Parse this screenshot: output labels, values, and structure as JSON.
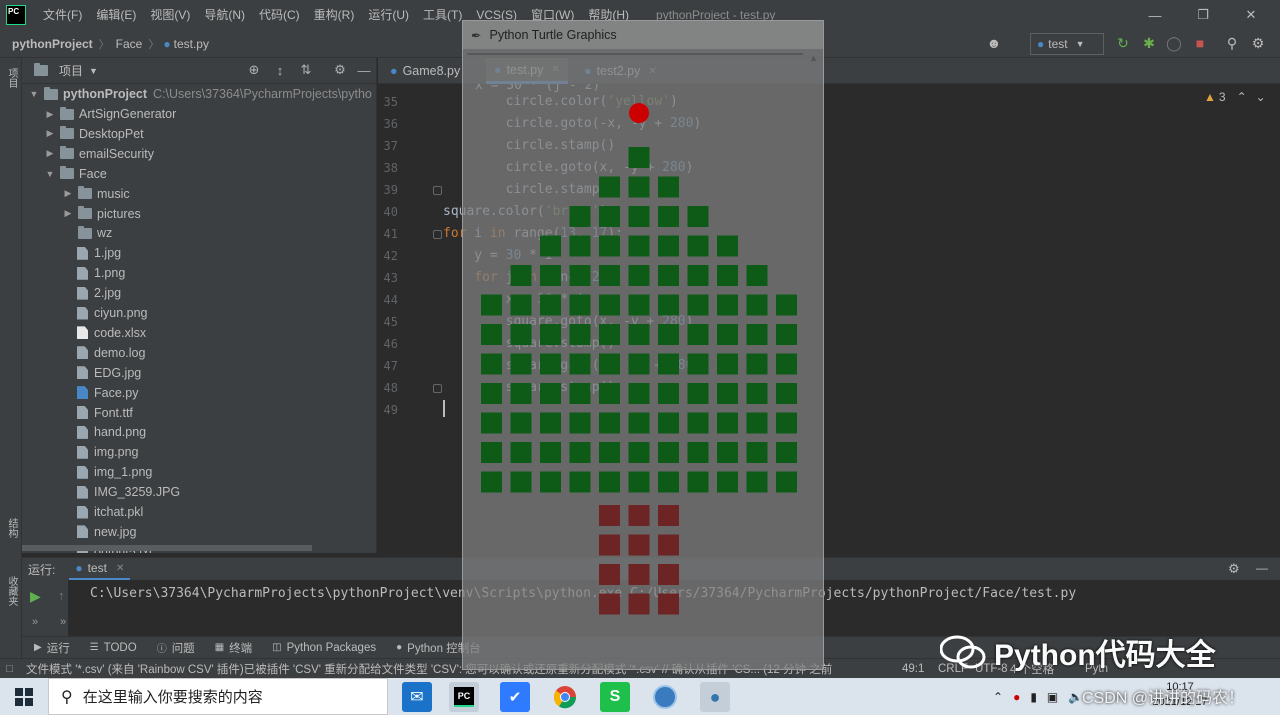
{
  "window": {
    "menu": [
      "文件(F)",
      "编辑(E)",
      "视图(V)",
      "导航(N)",
      "代码(C)",
      "重构(R)",
      "运行(U)",
      "工具(T)",
      "VCS(S)",
      "窗口(W)",
      "帮助(H)"
    ],
    "title": "pythonProject - test.py",
    "logo_text": "PC"
  },
  "breadcrumb": [
    "pythonProject",
    "Face",
    "test.py"
  ],
  "run_config": "test",
  "left_strip": {
    "project_label": "项目",
    "structure_label": "结构",
    "favorites_label": "收藏夹"
  },
  "project_panel": {
    "title": "项目",
    "root": {
      "name": "pythonProject",
      "path": "C:\\Users\\37364\\PycharmProjects\\pytho"
    },
    "items": [
      {
        "name": "ArtSignGenerator",
        "type": "folder",
        "level": 1,
        "expanded": false
      },
      {
        "name": "DesktopPet",
        "type": "folder",
        "level": 1,
        "expanded": false
      },
      {
        "name": "emailSecurity",
        "type": "folder",
        "level": 1,
        "expanded": false
      },
      {
        "name": "Face",
        "type": "folder",
        "level": 1,
        "expanded": true
      },
      {
        "name": "music",
        "type": "folder",
        "level": 2,
        "expanded": false
      },
      {
        "name": "pictures",
        "type": "folder",
        "level": 2,
        "expanded": false
      },
      {
        "name": "wz",
        "type": "folder",
        "level": 2,
        "expanded": null
      },
      {
        "name": "1.jpg",
        "type": "file",
        "level": 2
      },
      {
        "name": "1.png",
        "type": "file",
        "level": 2
      },
      {
        "name": "2.jpg",
        "type": "file",
        "level": 2
      },
      {
        "name": "ciyun.png",
        "type": "file",
        "level": 2
      },
      {
        "name": "code.xlsx",
        "type": "xlsx",
        "level": 2
      },
      {
        "name": "demo.log",
        "type": "file",
        "level": 2
      },
      {
        "name": "EDG.jpg",
        "type": "file",
        "level": 2
      },
      {
        "name": "Face.py",
        "type": "py",
        "level": 2
      },
      {
        "name": "Font.ttf",
        "type": "file",
        "level": 2
      },
      {
        "name": "hand.png",
        "type": "file",
        "level": 2
      },
      {
        "name": "img.png",
        "type": "file",
        "level": 2
      },
      {
        "name": "img_1.png",
        "type": "file",
        "level": 2
      },
      {
        "name": "IMG_3259.JPG",
        "type": "file",
        "level": 2
      },
      {
        "name": "itchat.pkl",
        "type": "file",
        "level": 2
      },
      {
        "name": "new.jpg",
        "type": "file",
        "level": 2
      },
      {
        "name": "output5.txt",
        "type": "file",
        "level": 2
      }
    ]
  },
  "editor": {
    "tabs": [
      {
        "label": "Game8.py",
        "active": false
      },
      {
        "label": "test.py",
        "active": true
      },
      {
        "label": "test2.py",
        "active": false
      }
    ],
    "warnings": "3",
    "first_partial_line": "x = 30 * (j - 2)",
    "lines": [
      {
        "n": 35,
        "text": "        circle.color('yellow')"
      },
      {
        "n": 36,
        "text": "        circle.goto(-x, -y + 280)"
      },
      {
        "n": 37,
        "text": "        circle.stamp()"
      },
      {
        "n": 38,
        "text": "        circle.goto(x, -y + 280)"
      },
      {
        "n": 39,
        "text": "        circle.stamp()"
      },
      {
        "n": 40,
        "text": "square.color('brown')"
      },
      {
        "n": 41,
        "text": "for i in range(13, 17):"
      },
      {
        "n": 42,
        "text": "    y = 30 * i"
      },
      {
        "n": 43,
        "text": "    for j in range(2):"
      },
      {
        "n": 44,
        "text": "        x = 30 * j"
      },
      {
        "n": 45,
        "text": "        square.goto(x, -y + 280)"
      },
      {
        "n": 46,
        "text": "        square.stamp()"
      },
      {
        "n": 47,
        "text": "        square.goto(-x, -y + 280)"
      },
      {
        "n": 48,
        "text": "        square.stamp()"
      },
      {
        "n": 49,
        "text": ""
      }
    ]
  },
  "run_panel": {
    "label": "运行:",
    "tab": "test",
    "command": "C:\\Users\\37364\\PycharmProjects\\pythonProject\\venv\\Scripts\\python.exe C:/Users/37364/PycharmProjects/pythonProject/Face/test.py"
  },
  "tool_tabs": [
    "运行",
    "TODO",
    "问题",
    "终端",
    "Python Packages",
    "Python 控制台"
  ],
  "status_bar": {
    "message": "文件模式 '*.csv' (来自 'Rainbow CSV' 插件)已被插件 'CSV' 重新分配给文件类型 'CSV': 您可以确认或还原重新分配模式 '*.csv' // 确认从插件 'CS... (12 分钟 之前",
    "position": "49:1",
    "line_sep": "CRLF",
    "encoding": "UTF-8",
    "indent": "4 个空格",
    "interpreter": "Pyth"
  },
  "turtle_window": {
    "title": "Python Turtle Graphics",
    "colors": {
      "leaf": "#0e5b17",
      "trunk": "#6d2424",
      "ornament": "#cc0000"
    },
    "tree_rows": [
      1,
      3,
      5,
      7,
      9,
      11,
      11,
      11,
      11,
      11,
      11,
      11
    ],
    "trunk_rows": 4,
    "trunk_width": 3
  },
  "taskbar": {
    "search_placeholder": "在这里输入你要搜索的内容",
    "clock_time": "10:17",
    "clock_date": "2021/12/17"
  },
  "watermark": {
    "brand": "Python代码大全",
    "sub": "CSDN @讲讲的码农！"
  }
}
